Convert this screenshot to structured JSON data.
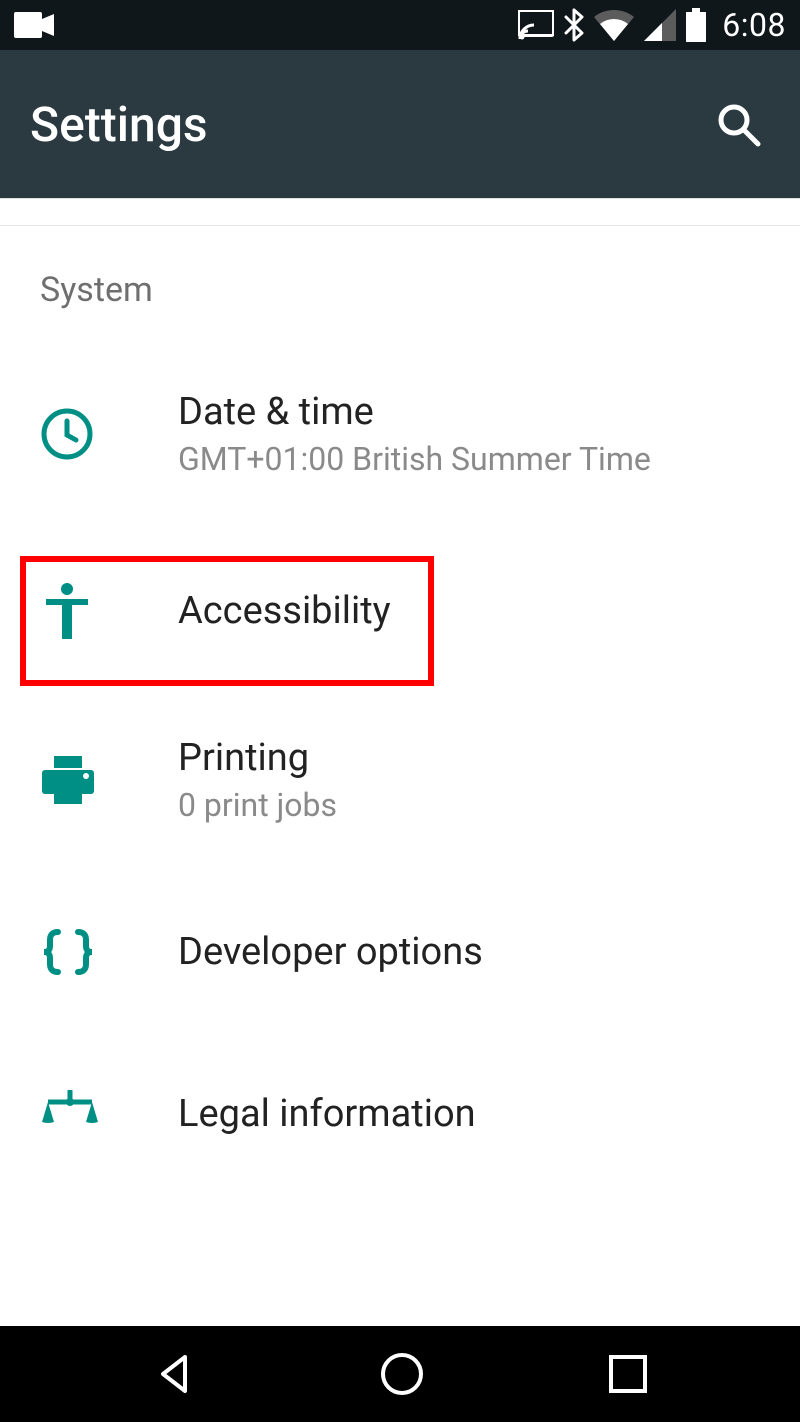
{
  "statusbar": {
    "time": "6:08"
  },
  "appbar": {
    "title": "Settings"
  },
  "section": {
    "header": "System"
  },
  "items": {
    "datetime": {
      "title": "Date & time",
      "sub": "GMT+01:00 British Summer Time"
    },
    "accessibility": {
      "title": "Accessibility"
    },
    "printing": {
      "title": "Printing",
      "sub": "0 print jobs"
    },
    "developer": {
      "title": "Developer options"
    },
    "legal": {
      "title": "Legal information"
    }
  },
  "colors": {
    "accent": "#008f84",
    "highlight": "#ff0000"
  }
}
